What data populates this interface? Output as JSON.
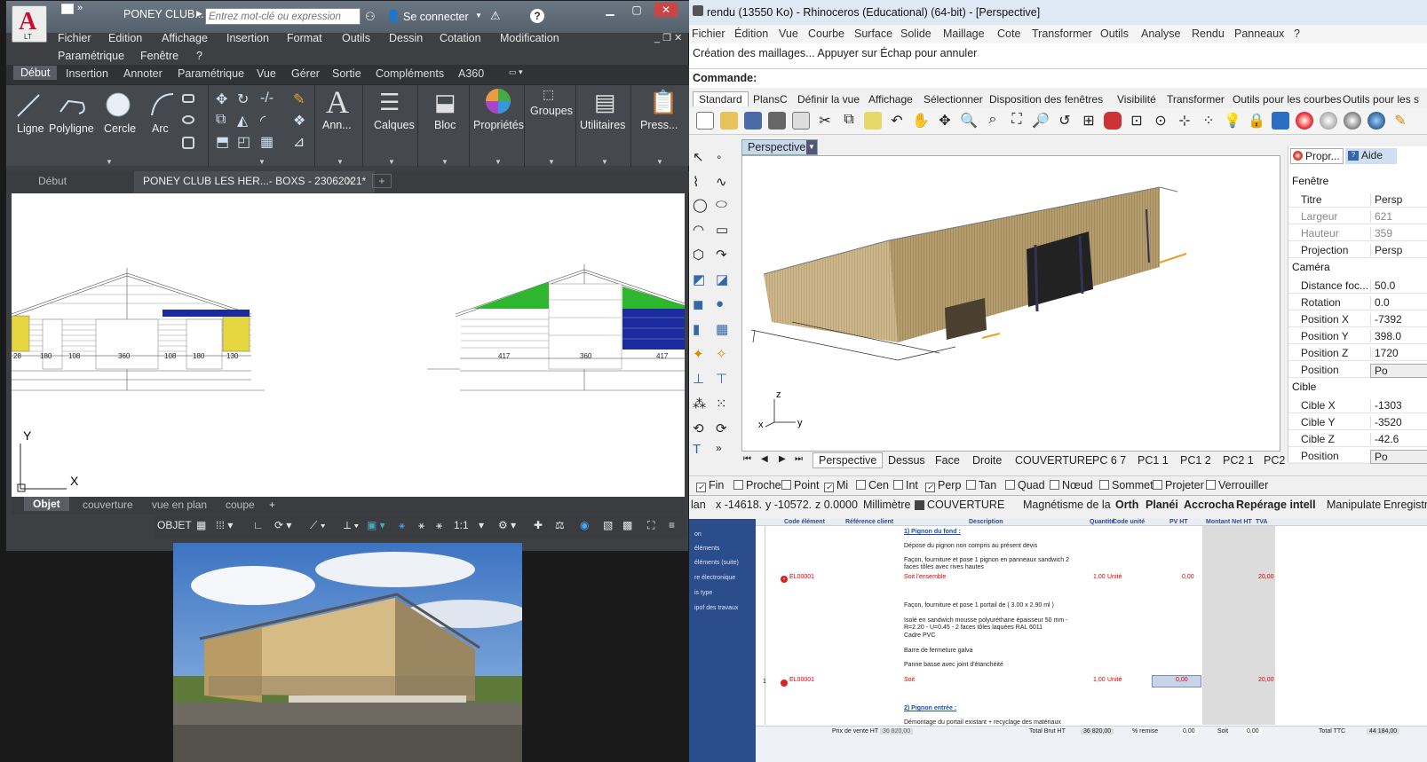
{
  "autocad": {
    "title": "PONEY CLUB...",
    "search_placeholder": "Entrez mot-clé ou expression",
    "signin": "Se connecter",
    "logo_sub": "LT",
    "menu": [
      "Fichier",
      "Edition",
      "Affichage",
      "Insertion",
      "Format",
      "Outils",
      "Dessin",
      "Cotation",
      "Modification",
      "Paramétrique",
      "Fenêtre",
      "?"
    ],
    "ribbon_tabs": [
      "Début",
      "Insertion",
      "Annoter",
      "Paramétrique",
      "Vue",
      "Gérer",
      "Sortie",
      "Compléments",
      "A360"
    ],
    "ribbon_tools": [
      "Ligne",
      "Polyligne",
      "Cercle",
      "Arc",
      "Ann...",
      "Calques",
      "Bloc",
      "Propriétés",
      "Groupes",
      "Utilitaires",
      "Press..."
    ],
    "doc_tabs": [
      "Début",
      "PONEY CLUB LES HER...- BOXS - 23062021*"
    ],
    "dims_left": [
      "28",
      "180",
      "108",
      "360",
      "108",
      "180",
      "130"
    ],
    "dims_right": [
      "417",
      "360",
      "417"
    ],
    "axis": {
      "y": "Y",
      "x": "X"
    },
    "layout_tabs": [
      "Objet",
      "couverture",
      "vue en plan",
      "coupe"
    ],
    "status": {
      "mode": "OBJET",
      "scale": "1:1"
    }
  },
  "rhino": {
    "title": "rendu (13550 Ko) - Rhinoceros (Educational) (64-bit) - [Perspective]",
    "menu": [
      "Fichier",
      "Édition",
      "Vue",
      "Courbe",
      "Surface",
      "Solide",
      "Maillage",
      "Cote",
      "Transformer",
      "Outils",
      "Analyse",
      "Rendu",
      "Panneaux",
      "?"
    ],
    "cmd_output": "Création des maillages... Appuyer sur Échap pour annuler",
    "cmd_label": "Commande:",
    "toolbar_tabs": [
      "Standard",
      "PlansC",
      "Définir la vue",
      "Affichage",
      "Sélectionner",
      "Disposition des fenêtres",
      "Visibilité",
      "Transformer",
      "Outils pour les courbes",
      "Outils pour les s"
    ],
    "viewport_title": "Perspective",
    "axes": {
      "z": "z",
      "y": "y",
      "x": "x"
    },
    "props_tabs": [
      "Propr...",
      "Aide"
    ],
    "sections": {
      "fenetre": "Fenêtre",
      "camera": "Caméra",
      "cible": "Cible"
    },
    "props_fenetre": [
      {
        "k": "Titre",
        "v": "Persp"
      },
      {
        "k": "Largeur",
        "v": "621"
      },
      {
        "k": "Hauteur",
        "v": "359"
      },
      {
        "k": "Projection",
        "v": "Persp"
      }
    ],
    "props_camera": [
      {
        "k": "Distance foc...",
        "v": "50.0"
      },
      {
        "k": "Rotation",
        "v": "0.0"
      },
      {
        "k": "Position X",
        "v": "-7392"
      },
      {
        "k": "Position Y",
        "v": "398.0"
      },
      {
        "k": "Position Z",
        "v": "1720"
      },
      {
        "k": "Position",
        "v": "Po"
      }
    ],
    "props_cible": [
      {
        "k": "Cible X",
        "v": "-1303"
      },
      {
        "k": "Cible Y",
        "v": "-3520"
      },
      {
        "k": "Cible Z",
        "v": "-42.6"
      },
      {
        "k": "Position",
        "v": "Po"
      }
    ],
    "view_tabs": [
      "Perspective",
      "Dessus",
      "Face",
      "Droite",
      "COUVERTURE",
      "PC 6 7",
      "PC1 1",
      "PC1 2",
      "PC2 1",
      "PC2"
    ],
    "osnaps": [
      {
        "n": "Fin",
        "c": true
      },
      {
        "n": "Proche",
        "c": false
      },
      {
        "n": "Point",
        "c": false
      },
      {
        "n": "Mi",
        "c": true
      },
      {
        "n": "Cen",
        "c": false
      },
      {
        "n": "Int",
        "c": false
      },
      {
        "n": "Perp",
        "c": true
      },
      {
        "n": "Tan",
        "c": false
      },
      {
        "n": "Quad",
        "c": false
      },
      {
        "n": "Nœud",
        "c": false
      },
      {
        "n": "Sommet",
        "c": false
      },
      {
        "n": "Projeter",
        "c": false
      },
      {
        "n": "Verrouiller",
        "c": false
      }
    ],
    "status": [
      "lan",
      "x -14618.",
      "y -10572.",
      "z 0.0000",
      "Millimètre",
      "COUVERTURE",
      "Magnétisme de la",
      "Orth",
      "Planéi",
      "Accrocha",
      "Repérage intell",
      "Manipulate",
      "Enregistre"
    ]
  },
  "quote": {
    "left_items": [
      "on",
      "éléments",
      "éléments (suite)",
      "re électronique",
      "is type",
      "ipof des travaux"
    ],
    "headers": [
      "Code élément",
      "Référence client",
      "Description",
      "Quantité",
      "Code unité",
      "PV HT",
      "Montant Net HT",
      "TVA"
    ],
    "rows": [
      {
        "desc": "1) Pignon du fond :",
        "type": "section"
      },
      {
        "desc": "Dépose du pignon non compris au présent devis"
      },
      {
        "desc": "Façon, fourniture et pose 1 pignon en panneaux sandwich 2"
      },
      {
        "desc": "faces tôles avec rives hautes"
      },
      {
        "code": "EL00001",
        "desc": "Soit l'ensemble",
        "qty": "1,00",
        "unit": "Unité",
        "pv": "0,00",
        "tva": "20,00",
        "type": "item"
      },
      {
        "desc": "Façon, fourniture et pose 1 portail de ( 3.00 x 2.90 ml )"
      },
      {
        "desc": "Isolé en sandwich mousse polyuréthane épaisseur 50 mm -"
      },
      {
        "desc": "R=2.20 - U=0.45 - 2 faces tôles laquées RAL 6011"
      },
      {
        "desc": "Cadre PVC"
      },
      {
        "desc": "Barre de fermeture galva"
      },
      {
        "desc": "Panne basse avec joint d'étanchéité"
      },
      {
        "num": "1",
        "code": "EL00001",
        "desc": "Soit",
        "qty": "1,00",
        "unit": "Unité",
        "pv": "0,00",
        "tva": "20,00",
        "type": "item"
      },
      {
        "desc": "2) Pignon entrée :",
        "type": "section"
      },
      {
        "desc": "Démontage du portail existant + recyclage des matériaux"
      }
    ],
    "footer": {
      "pv_label": "Prix de vente HT",
      "pv": "36 820,00",
      "tb_label": "Total Brut HT",
      "tb": "36 820,00",
      "remise_label": "% remise",
      "remise": "0,00",
      "soit_label": "Soit",
      "soit": "0,00",
      "ttc_label": "Total TTC",
      "ttc": "44 184,00"
    }
  }
}
